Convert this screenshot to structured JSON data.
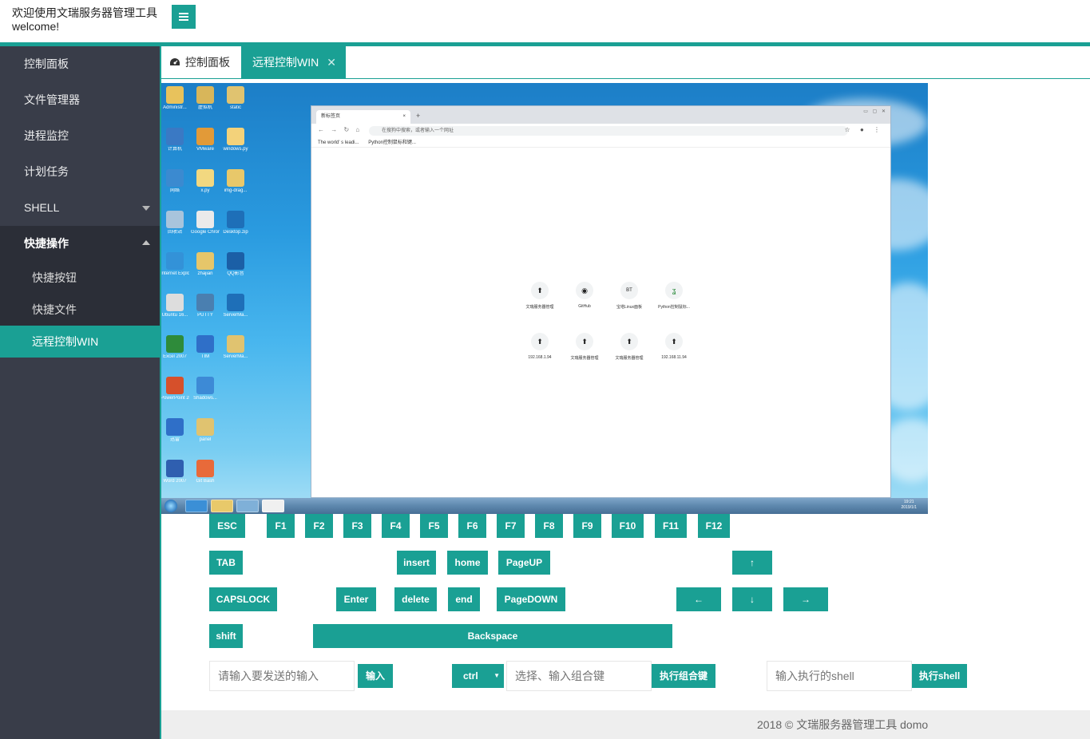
{
  "header": {
    "welcome_line1": "欢迎使用文瑞服务器管理工具",
    "welcome_line2": "welcome!",
    "menu_icon": "hamburger-icon"
  },
  "colors": {
    "accent": "#1aa094",
    "sidebar": "#393d49",
    "sidebar_dark": "#2b2e37"
  },
  "sidebar": {
    "items": [
      {
        "label": "控制面板"
      },
      {
        "label": "文件管理器"
      },
      {
        "label": "进程监控"
      },
      {
        "label": "计划任务"
      },
      {
        "label": "SHELL"
      },
      {
        "label": "快捷操作"
      }
    ],
    "sub_items": [
      {
        "label": "快捷按钮"
      },
      {
        "label": "快捷文件"
      },
      {
        "label": "远程控制WIN"
      }
    ]
  },
  "tabs": {
    "home_label": "控制面板",
    "home_icon": "dashboard-icon",
    "active_label": "远程控制WIN",
    "close_glyph": "✕"
  },
  "remote": {
    "desktop_icons": [
      "Administr...",
      "虚拟机",
      "static",
      "计算机",
      "VMware",
      "windows.py",
      "网络",
      "x.py",
      "img-drag...",
      "回收站",
      "Google Chrome",
      "Desktop.zip",
      "Internet Explorer",
      "zhajian",
      "QQ影音",
      "Ubuntu 16...",
      "PUTTY",
      "ServerMa...",
      "Excel 2007",
      "TIM",
      "ServerMa...",
      "PowerPoint 2007",
      "Shadows...",
      "迅雷",
      "panel",
      "Word 2007",
      "Git Bash"
    ],
    "browser": {
      "tab_title": "新标签页",
      "address_placeholder": "在搜狗中搜索，或者输入一个网址",
      "bookmarks": [
        "The world' s leadi...",
        "Python控制鼠标和键..."
      ],
      "shortcuts_row1": [
        "文瑞服务器管理",
        "GitHub",
        "宝塔Linux面板",
        "Python控制鼠标..."
      ],
      "shortcuts_row2": [
        "192.168.1.94",
        "文瑞服务器管理",
        "文瑞服务器管理",
        "192.168.11.94"
      ]
    },
    "clock_time": "19:21",
    "clock_date": "2019/1/1"
  },
  "keyboard": {
    "row1": [
      "ESC",
      "F1",
      "F2",
      "F3",
      "F4",
      "F5",
      "F6",
      "F7",
      "F8",
      "F9",
      "F10",
      "F11",
      "F12"
    ],
    "tab": "TAB",
    "insert": "insert",
    "home": "home",
    "pageup": "PageUP",
    "up": "↑",
    "capslock": "CAPSLOCK",
    "enter": "Enter",
    "delete": "delete",
    "end": "end",
    "pagedown": "PageDOWN",
    "left": "←",
    "down": "↓",
    "right": "→",
    "shift": "shift",
    "backspace": "Backspace"
  },
  "controls": {
    "text_input_placeholder": "请输入要发送的输入",
    "text_submit": "输入",
    "modifier_value": "ctrl",
    "combo_placeholder": "选择、输入组合键",
    "combo_submit": "执行组合键",
    "shell_placeholder": "输入执行的shell",
    "shell_submit": "执行shell"
  },
  "footer": {
    "text": "2018 ©  文瑞服务器管理工具  domo"
  }
}
